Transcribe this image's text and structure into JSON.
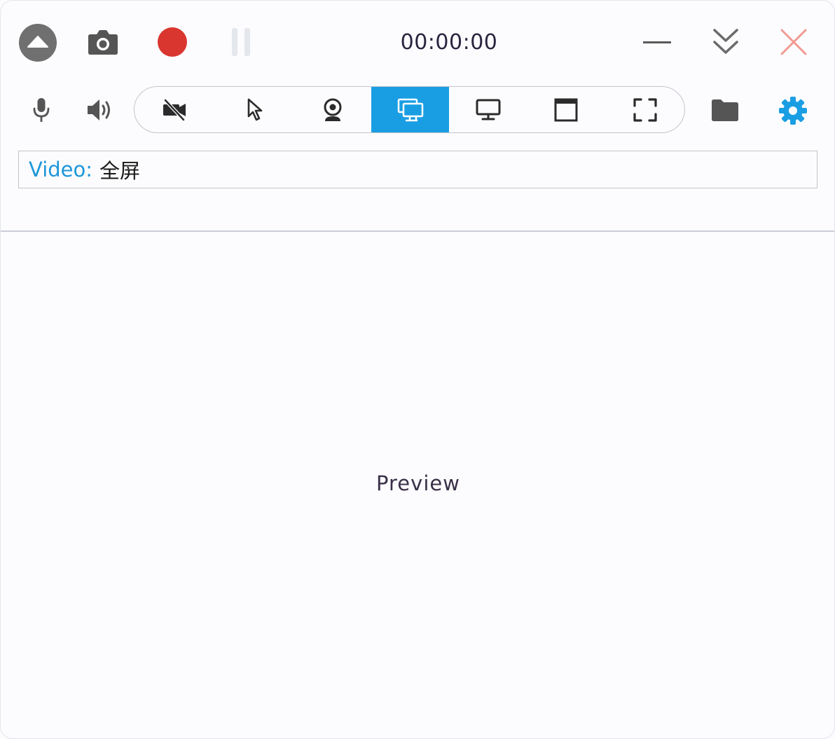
{
  "toolbar": {
    "timer": "00:00:00",
    "icons": {
      "collapse": "eject-up-icon",
      "screenshot": "camera-icon",
      "record": "record-icon",
      "pause": "pause-icon",
      "minimize": "minimize-icon",
      "expand": "double-chevron-down-icon",
      "close": "close-icon"
    },
    "colors": {
      "record": "#d9362f",
      "close": "#f19a92",
      "accent": "#1a9ee3"
    }
  },
  "source_bar": {
    "audio": [
      "microphone-icon",
      "speaker-icon"
    ],
    "modes": [
      {
        "icon": "no-camera-icon",
        "active": false
      },
      {
        "icon": "cursor-icon",
        "active": false
      },
      {
        "icon": "webcam-icon",
        "active": false
      },
      {
        "icon": "screen-share-icon",
        "active": true
      },
      {
        "icon": "monitor-icon",
        "active": false
      },
      {
        "icon": "window-icon",
        "active": false
      },
      {
        "icon": "region-icon",
        "active": false
      }
    ],
    "folder": "folder-icon",
    "settings": "gear-icon"
  },
  "video": {
    "label": "Video:",
    "value": "全屏"
  },
  "preview": {
    "text": "Preview"
  }
}
